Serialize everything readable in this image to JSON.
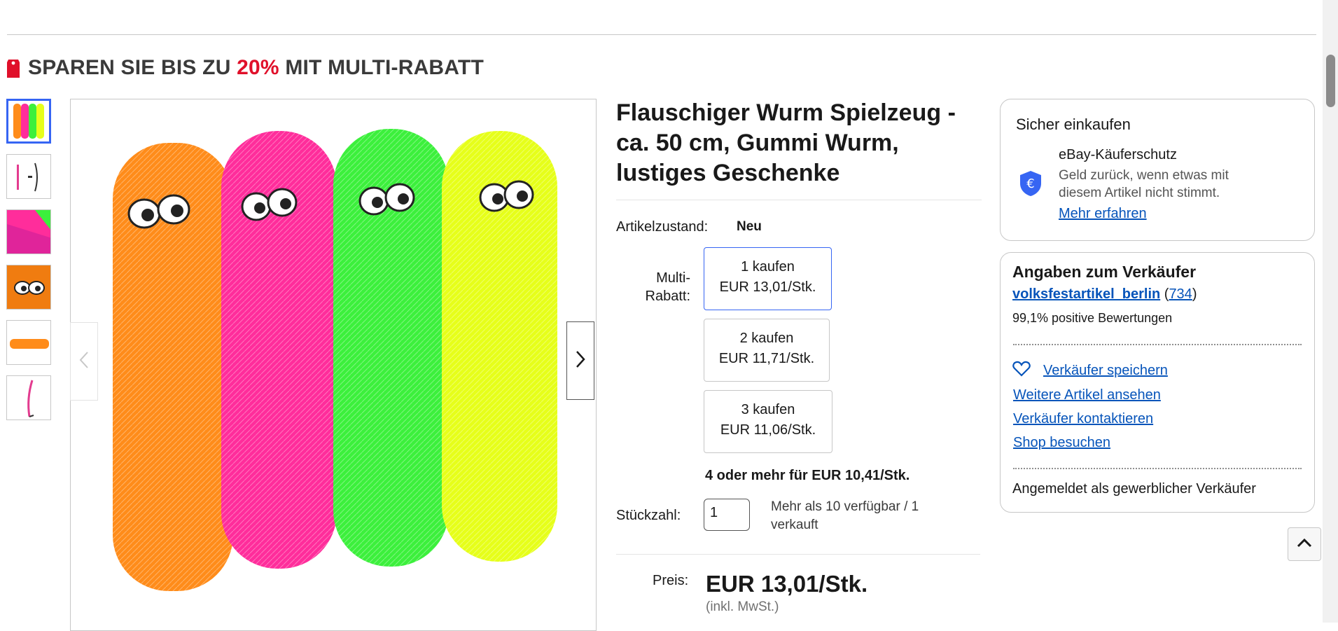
{
  "promo": {
    "prefix": "SPAREN SIE BIS ZU",
    "percent": "20%",
    "suffix": "MIT MULTI-RABATT",
    "tag_icon": "price-tag-icon",
    "accent_color": "#e0102a"
  },
  "gallery": {
    "thumbnail_count": 6,
    "active_index": 0,
    "prev_icon": "chevron-left-icon",
    "next_icon": "chevron-right-icon"
  },
  "product": {
    "title": "Flauschiger Wurm Spielzeug - ca. 50 cm, Gummi Wurm, lustiges Geschenke",
    "condition_label": "Artikelzustand:",
    "condition_value": "Neu",
    "multi_label": "Multi-Rabatt:",
    "tiers": [
      {
        "qty": "1 kaufen",
        "price": "EUR 13,01/Stk.",
        "selected": true
      },
      {
        "qty": "2 kaufen",
        "price": "EUR 11,71/Stk.",
        "selected": false
      },
      {
        "qty": "3 kaufen",
        "price": "EUR 11,06/Stk.",
        "selected": false
      }
    ],
    "more_tier": "4 oder mehr für EUR 10,41/Stk.",
    "qty_label": "Stückzahl:",
    "qty_value": "1",
    "availability": "Mehr als 10 verfügbar / 1 verkauft",
    "price_label": "Preis:",
    "price": "EUR 13,01/Stk.",
    "vat_note": "(inkl. MwSt.)"
  },
  "safe_shopping": {
    "heading": "Sicher einkaufen",
    "protection_title": "eBay-Käuferschutz",
    "protection_text": "Geld zurück, wenn etwas mit diesem Artikel nicht stimmt.",
    "learn_more": "Mehr erfahren",
    "icon": "euro-shield-icon"
  },
  "seller": {
    "heading": "Angaben zum Verkäufer",
    "name": "volksfestartikel_berlin",
    "feedback_count": "734",
    "positive": "99,1% positive Bewertungen",
    "save_seller": "Verkäufer speichern",
    "more_items": "Weitere Artikel ansehen",
    "contact": "Verkäufer kontaktieren",
    "shop": "Shop besuchen",
    "account_type": "Angemeldet als gewerblicher Verkäufer",
    "heart_icon": "heart-icon"
  },
  "colors": {
    "link": "#0654ba",
    "selected_border": "#3665f3",
    "worm_orange": "#ff8c1a",
    "worm_pink": "#ff2d9b",
    "worm_green": "#3cf03c",
    "worm_yellow": "#e6ff1a"
  }
}
